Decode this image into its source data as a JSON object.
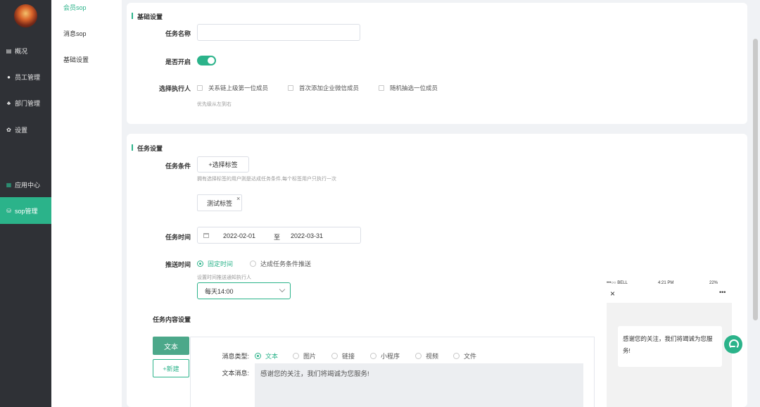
{
  "nav": {
    "items": [
      {
        "label": "概况",
        "icon": "overview-icon"
      },
      {
        "label": "员工管理",
        "icon": "user-icon"
      },
      {
        "label": "部门管理",
        "icon": "org-icon"
      },
      {
        "label": "设置",
        "icon": "gear-icon"
      },
      {
        "label": "应用中心",
        "icon": "apps-icon"
      },
      {
        "label": "sop管理",
        "icon": "database-icon"
      }
    ],
    "active_index": 5
  },
  "submenu": {
    "items": [
      "会员sop",
      "消息sop",
      "基础设置"
    ],
    "active_index": 0
  },
  "basic": {
    "title": "基础设置",
    "task_name_label": "任务名称",
    "task_name_value": "",
    "enabled_label": "是否开启",
    "enabled": true,
    "executor_label": "选择执行人",
    "executor_options": [
      "关系链上级第一位成员",
      "首次添加企业微信成员",
      "随机抽选一位成员"
    ],
    "executor_hint": "优先级从左到右"
  },
  "task": {
    "title": "任务设置",
    "condition_label": "任务条件",
    "select_tag_button": "+选择标签",
    "condition_hint": "拥有选择标签的用户则是达成任务条件,每个标签用户只执行一次",
    "tags": [
      "测试标签"
    ],
    "time_label": "任务时间",
    "start_date": "2022-02-01",
    "range_sep": "至",
    "end_date": "2022-03-31",
    "push_label": "推送时间",
    "push_options": [
      "固定时间",
      "达成任务条件推送"
    ],
    "push_selected": 0,
    "push_hint": "设置时间推送通知执行人",
    "push_time": "每天14:00",
    "content_label": "任务内容设置",
    "text_tab": "文本",
    "new_button": "+新建",
    "msg_type_label": "消息类型:",
    "msg_types": [
      "文本",
      "图片",
      "链接",
      "小程序",
      "视频",
      "文件"
    ],
    "msg_type_selected": 0,
    "text_msg_label": "文本消息:",
    "text_msg_value": "感谢您的关注，我们将竭诚为您服务!"
  },
  "preview": {
    "carrier": "•••○○ BELL",
    "time": "4:21 PM",
    "battery": "22%",
    "more": "•••",
    "close": "×",
    "bubble_text": "感谢您的关注，我们将竭诚为您服务!"
  },
  "colors": {
    "accent": "#2bb38a",
    "sidebar": "#2f3136"
  }
}
